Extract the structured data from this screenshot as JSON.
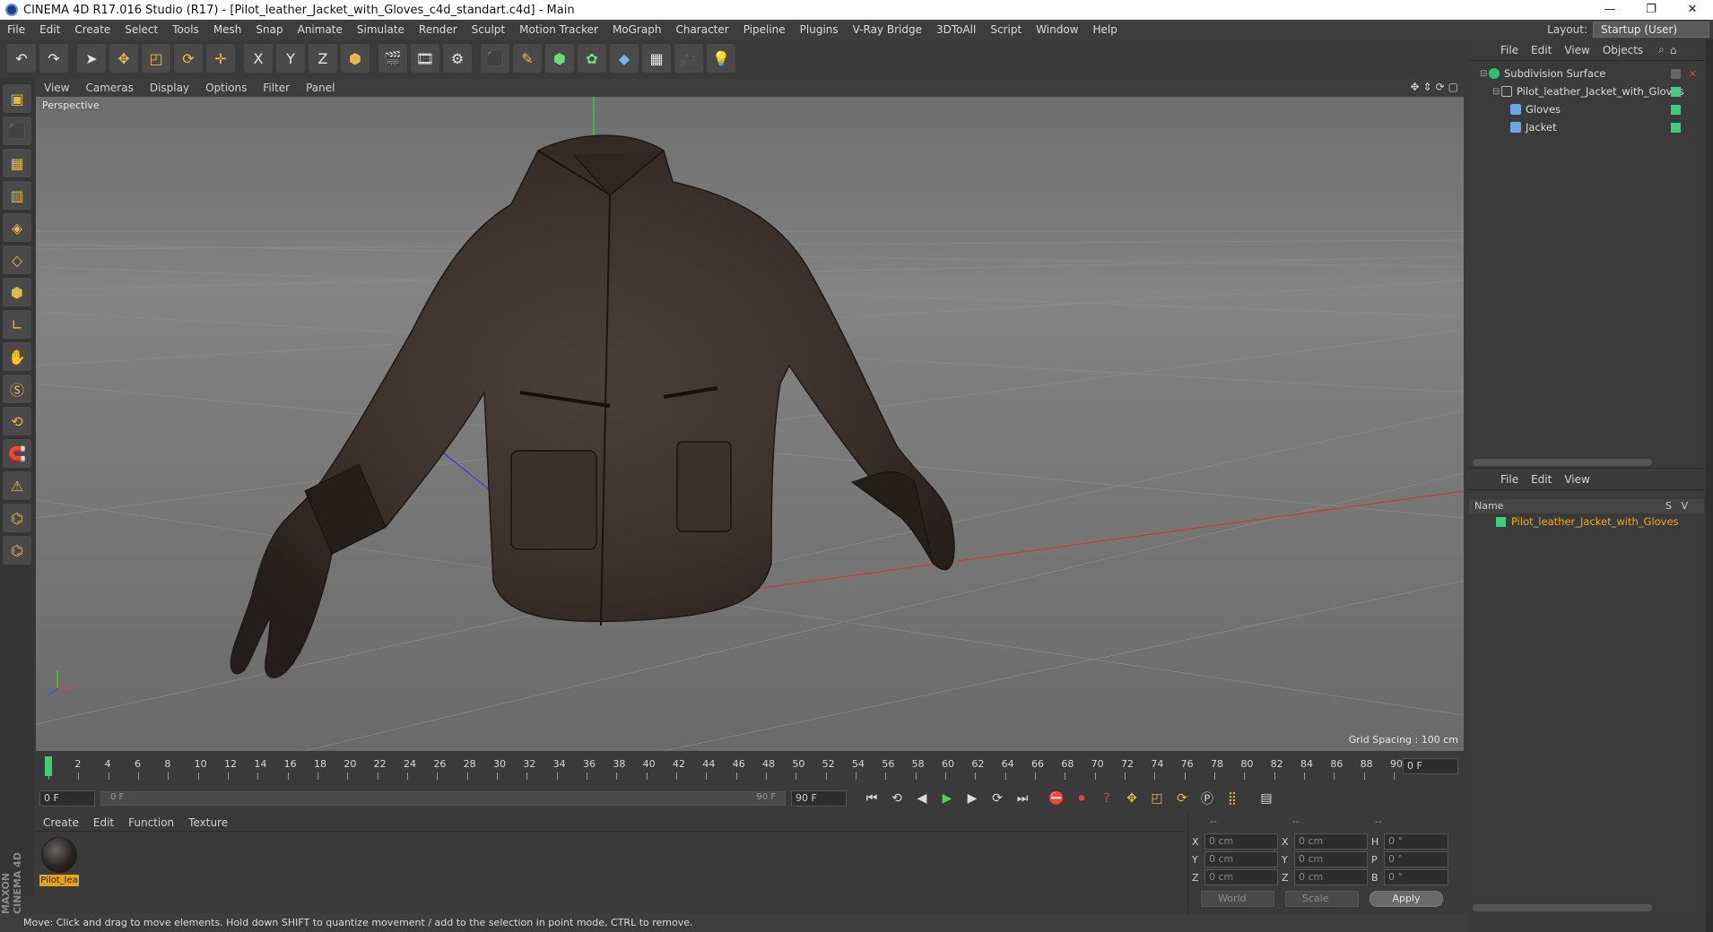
{
  "window": {
    "title": "CINEMA 4D R17.016 Studio (R17) - [Pilot_leather_Jacket_with_Gloves_c4d_standart.c4d] - Main",
    "controls": [
      "—",
      "❐",
      "✕"
    ]
  },
  "menubar": {
    "items": [
      "File",
      "Edit",
      "Create",
      "Select",
      "Tools",
      "Mesh",
      "Snap",
      "Animate",
      "Simulate",
      "Render",
      "Sculpt",
      "Motion Tracker",
      "MoGraph",
      "Character",
      "Pipeline",
      "Plugins",
      "V-Ray Bridge",
      "3DToAll",
      "Script",
      "Window",
      "Help"
    ],
    "layout_label": "Layout:",
    "layout_value": "Startup (User)"
  },
  "toolbar": {
    "icons": [
      {
        "name": "undo-icon",
        "glyph": "↶",
        "tone": "white"
      },
      {
        "name": "redo-icon",
        "glyph": "↷",
        "tone": "white"
      },
      {
        "name": "select-icon",
        "glyph": "➤",
        "tone": "white"
      },
      {
        "name": "move-icon",
        "glyph": "✥",
        "tone": "orange"
      },
      {
        "name": "scale-icon",
        "glyph": "◰",
        "tone": "orange"
      },
      {
        "name": "rotate-icon",
        "glyph": "⟳",
        "tone": "orange"
      },
      {
        "name": "transform-icon",
        "glyph": "✛",
        "tone": "orange"
      },
      {
        "name": "x-axis-icon",
        "glyph": "X",
        "tone": "white"
      },
      {
        "name": "y-axis-icon",
        "glyph": "Y",
        "tone": "white"
      },
      {
        "name": "z-axis-icon",
        "glyph": "Z",
        "tone": "white"
      },
      {
        "name": "coordinate-system-icon",
        "glyph": "⬢",
        "tone": "orange"
      },
      {
        "name": "render-view-icon",
        "glyph": "🎬",
        "tone": "white"
      },
      {
        "name": "render-picture-viewer-icon",
        "glyph": "🎞",
        "tone": "white"
      },
      {
        "name": "render-settings-icon",
        "glyph": "⚙",
        "tone": "white"
      },
      {
        "name": "cube-icon",
        "glyph": "⬛",
        "tone": "blue"
      },
      {
        "name": "pen-spline-icon",
        "glyph": "✎",
        "tone": "orange"
      },
      {
        "name": "subdivision-icon",
        "glyph": "⬢",
        "tone": "green"
      },
      {
        "name": "cloner-icon",
        "glyph": "✿",
        "tone": "green"
      },
      {
        "name": "deformer-icon",
        "glyph": "◆",
        "tone": "blue"
      },
      {
        "name": "floor-icon",
        "glyph": "▦",
        "tone": "white"
      },
      {
        "name": "camera-icon",
        "glyph": "🎥",
        "tone": "white"
      },
      {
        "name": "light-icon",
        "glyph": "💡",
        "tone": "white"
      }
    ]
  },
  "lefttools": {
    "icons": [
      "model-mode-icon",
      "object-mode-icon",
      "texture-mode-icon",
      "workplane-icon",
      "points-mode-icon",
      "edges-mode-icon",
      "polygons-mode-icon",
      "axis-mode-icon",
      "tweak-mode-icon",
      "solo-icon",
      "snap-icon",
      "magnet-icon",
      "lock-workplane-icon",
      "python-icon",
      "python-alt-icon"
    ],
    "brand": "MAXON CINEMA 4D"
  },
  "viewport": {
    "menu": [
      "View",
      "Cameras",
      "Display",
      "Options",
      "Filter",
      "Panel"
    ],
    "camera_label": "Perspective",
    "grid_spacing": "Grid Spacing : 100 cm"
  },
  "timeline": {
    "ticks": [
      "0",
      "2",
      "4",
      "6",
      "8",
      "10",
      "12",
      "14",
      "16",
      "18",
      "20",
      "22",
      "24",
      "26",
      "28",
      "30",
      "32",
      "34",
      "36",
      "38",
      "40",
      "42",
      "44",
      "46",
      "48",
      "50",
      "52",
      "54",
      "56",
      "58",
      "60",
      "62",
      "64",
      "66",
      "68",
      "70",
      "72",
      "74",
      "76",
      "78",
      "80",
      "82",
      "84",
      "86",
      "88",
      "90"
    ],
    "current_frame": "0 F"
  },
  "playback": {
    "start_field": "0 F",
    "range_start": "0 F",
    "range_end": "90 F",
    "end_field": "90 F"
  },
  "material_manager": {
    "menu": [
      "Create",
      "Edit",
      "Function",
      "Texture"
    ],
    "material_label": "Pilot_lea"
  },
  "coordinates": {
    "header": [
      "--",
      "--",
      "--"
    ],
    "rows": [
      {
        "a": "X",
        "av": "0 cm",
        "b": "X",
        "bv": "0 cm",
        "c": "H",
        "cv": "0 °"
      },
      {
        "a": "Y",
        "av": "0 cm",
        "b": "Y",
        "bv": "0 cm",
        "c": "P",
        "cv": "0 °"
      },
      {
        "a": "Z",
        "av": "0 cm",
        "b": "Z",
        "bv": "0 cm",
        "c": "B",
        "cv": "0 °"
      }
    ],
    "world": "World",
    "scale": "Scale",
    "apply": "Apply"
  },
  "object_manager": {
    "menu": [
      "File",
      "Edit",
      "View",
      "Objects"
    ],
    "tree": [
      {
        "label": "Subdivision Surface",
        "depth": 0
      },
      {
        "label": "Pilot_leather_Jacket_with_Gloves",
        "depth": 1
      },
      {
        "label": "Gloves",
        "depth": 2
      },
      {
        "label": "Jacket",
        "depth": 2
      }
    ]
  },
  "attribute_manager": {
    "menu": [
      "File",
      "Edit",
      "View"
    ],
    "col_name": "Name",
    "col_s": "S",
    "col_v": "V",
    "item": "Pilot_leather_Jacket_with_Gloves"
  },
  "statusbar": {
    "text": "Move: Click and drag to move elements. Hold down SHIFT to quantize movement / add to the selection in point mode, CTRL to remove."
  },
  "colors": {
    "accent_orange": "#e8a31c",
    "object_green": "#3fcf7b",
    "viewport_bg": "#777777"
  }
}
